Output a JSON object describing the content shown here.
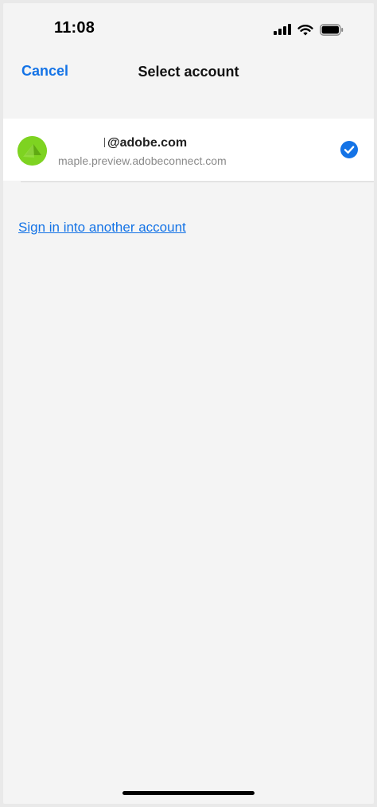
{
  "status_bar": {
    "time": "11:08",
    "icons": [
      "signal-icon",
      "wifi-icon",
      "battery-icon"
    ]
  },
  "nav": {
    "cancel_label": "Cancel",
    "title": "Select account"
  },
  "account": {
    "email_visible": "@adobe.com",
    "server": "maple.preview.adobeconnect.com",
    "selected": true,
    "avatar_color": "#7ed321",
    "check_color": "#1473e6"
  },
  "sign_in_link": "Sign in into another account",
  "colors": {
    "accent": "#1473e6",
    "background": "#f4f4f4"
  }
}
